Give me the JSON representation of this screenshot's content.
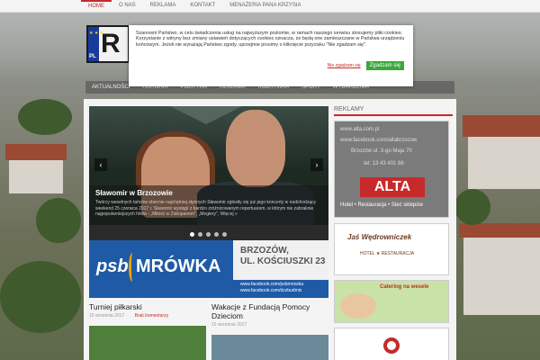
{
  "top_nav": {
    "items": [
      "Home",
      "O nas",
      "Reklama",
      "Kontakt",
      "Menażeria Pana Krzysia"
    ]
  },
  "logo": {
    "text": "R",
    "country": "PL",
    "stars": "★ ★ ★"
  },
  "main_nav": {
    "items": [
      "Aktualności",
      "Historia",
      "Polityka",
      "Reklama",
      "Rozrywka",
      "Sport",
      "Wydarzenia"
    ]
  },
  "slider": {
    "title": "Sławomir w Brzozowie",
    "excerpt": "Twórcy weselnych tańców obecnie najchętniej słynnych Sławomir zgłosiły się już jego koncerty w nadchodzący weekend 25 czerwca 2017 r. Sławomir wystąpi z bardzo zróżnicowanym repertuarem, w którym nie zabraknie najpopularniejszych hitów - „Miłość w Zakopanem\", „Megiery\", Więcej »",
    "prev": "‹",
    "next": "›"
  },
  "banner": {
    "brand1": "psb",
    "brand2": "MRÓWKA",
    "city_line1": "BRZOZÓW,",
    "city_line2": "UL. KOŚCIUSZKI 23",
    "web1": "www.facebook.com/psbmrowka",
    "web2": "www.facebook.com/dzzbudmix"
  },
  "articles": [
    {
      "title": "Turniej piłkarski",
      "date": "15 września 2017",
      "comments": "Brak komentarzy"
    },
    {
      "title": "Wakacje z Fundacją Pomocy Dzieciom",
      "date": "15 września 2017",
      "comments": ""
    }
  ],
  "sidebar": {
    "heading": "Reklamy",
    "alta": {
      "lines": [
        "www.alta.com.pl",
        "www.facebook.com/altabrzozow",
        "Brzozów ul. 3-go Maja 70",
        "tel: 13 43 401 66"
      ],
      "name": "ALTA",
      "services": "Hotel • Restauracja • Sieć sklepów"
    },
    "jas": {
      "name": "Jaś Wędrowniczek",
      "sub": "HOTEL ★ RESTAURACJA"
    },
    "catering": {
      "title": "Catering na wesele"
    }
  },
  "cookie": {
    "text": "Szanowni Państwo, w celu świadczenia usług na najwyższym poziomie, w ramach naszego serwisu stosujemy pliki cookies. Korzystanie z witryny bez zmiany ustawień dotyczących cookies oznacza, że będą one zamieszczane w Państwa urządzeniu końcowym. Jeżeli nie wyrażają Państwo zgody, uprzejmie prosimy o kliknięcie przycisku \"Nie zgadzam się\".",
    "decline": "Nie zgadzam się",
    "accept": "Zgadzam się"
  },
  "colors": {
    "accent": "#c62a2a",
    "accept": "#3aa83a",
    "banner": "#1f5aa6"
  }
}
